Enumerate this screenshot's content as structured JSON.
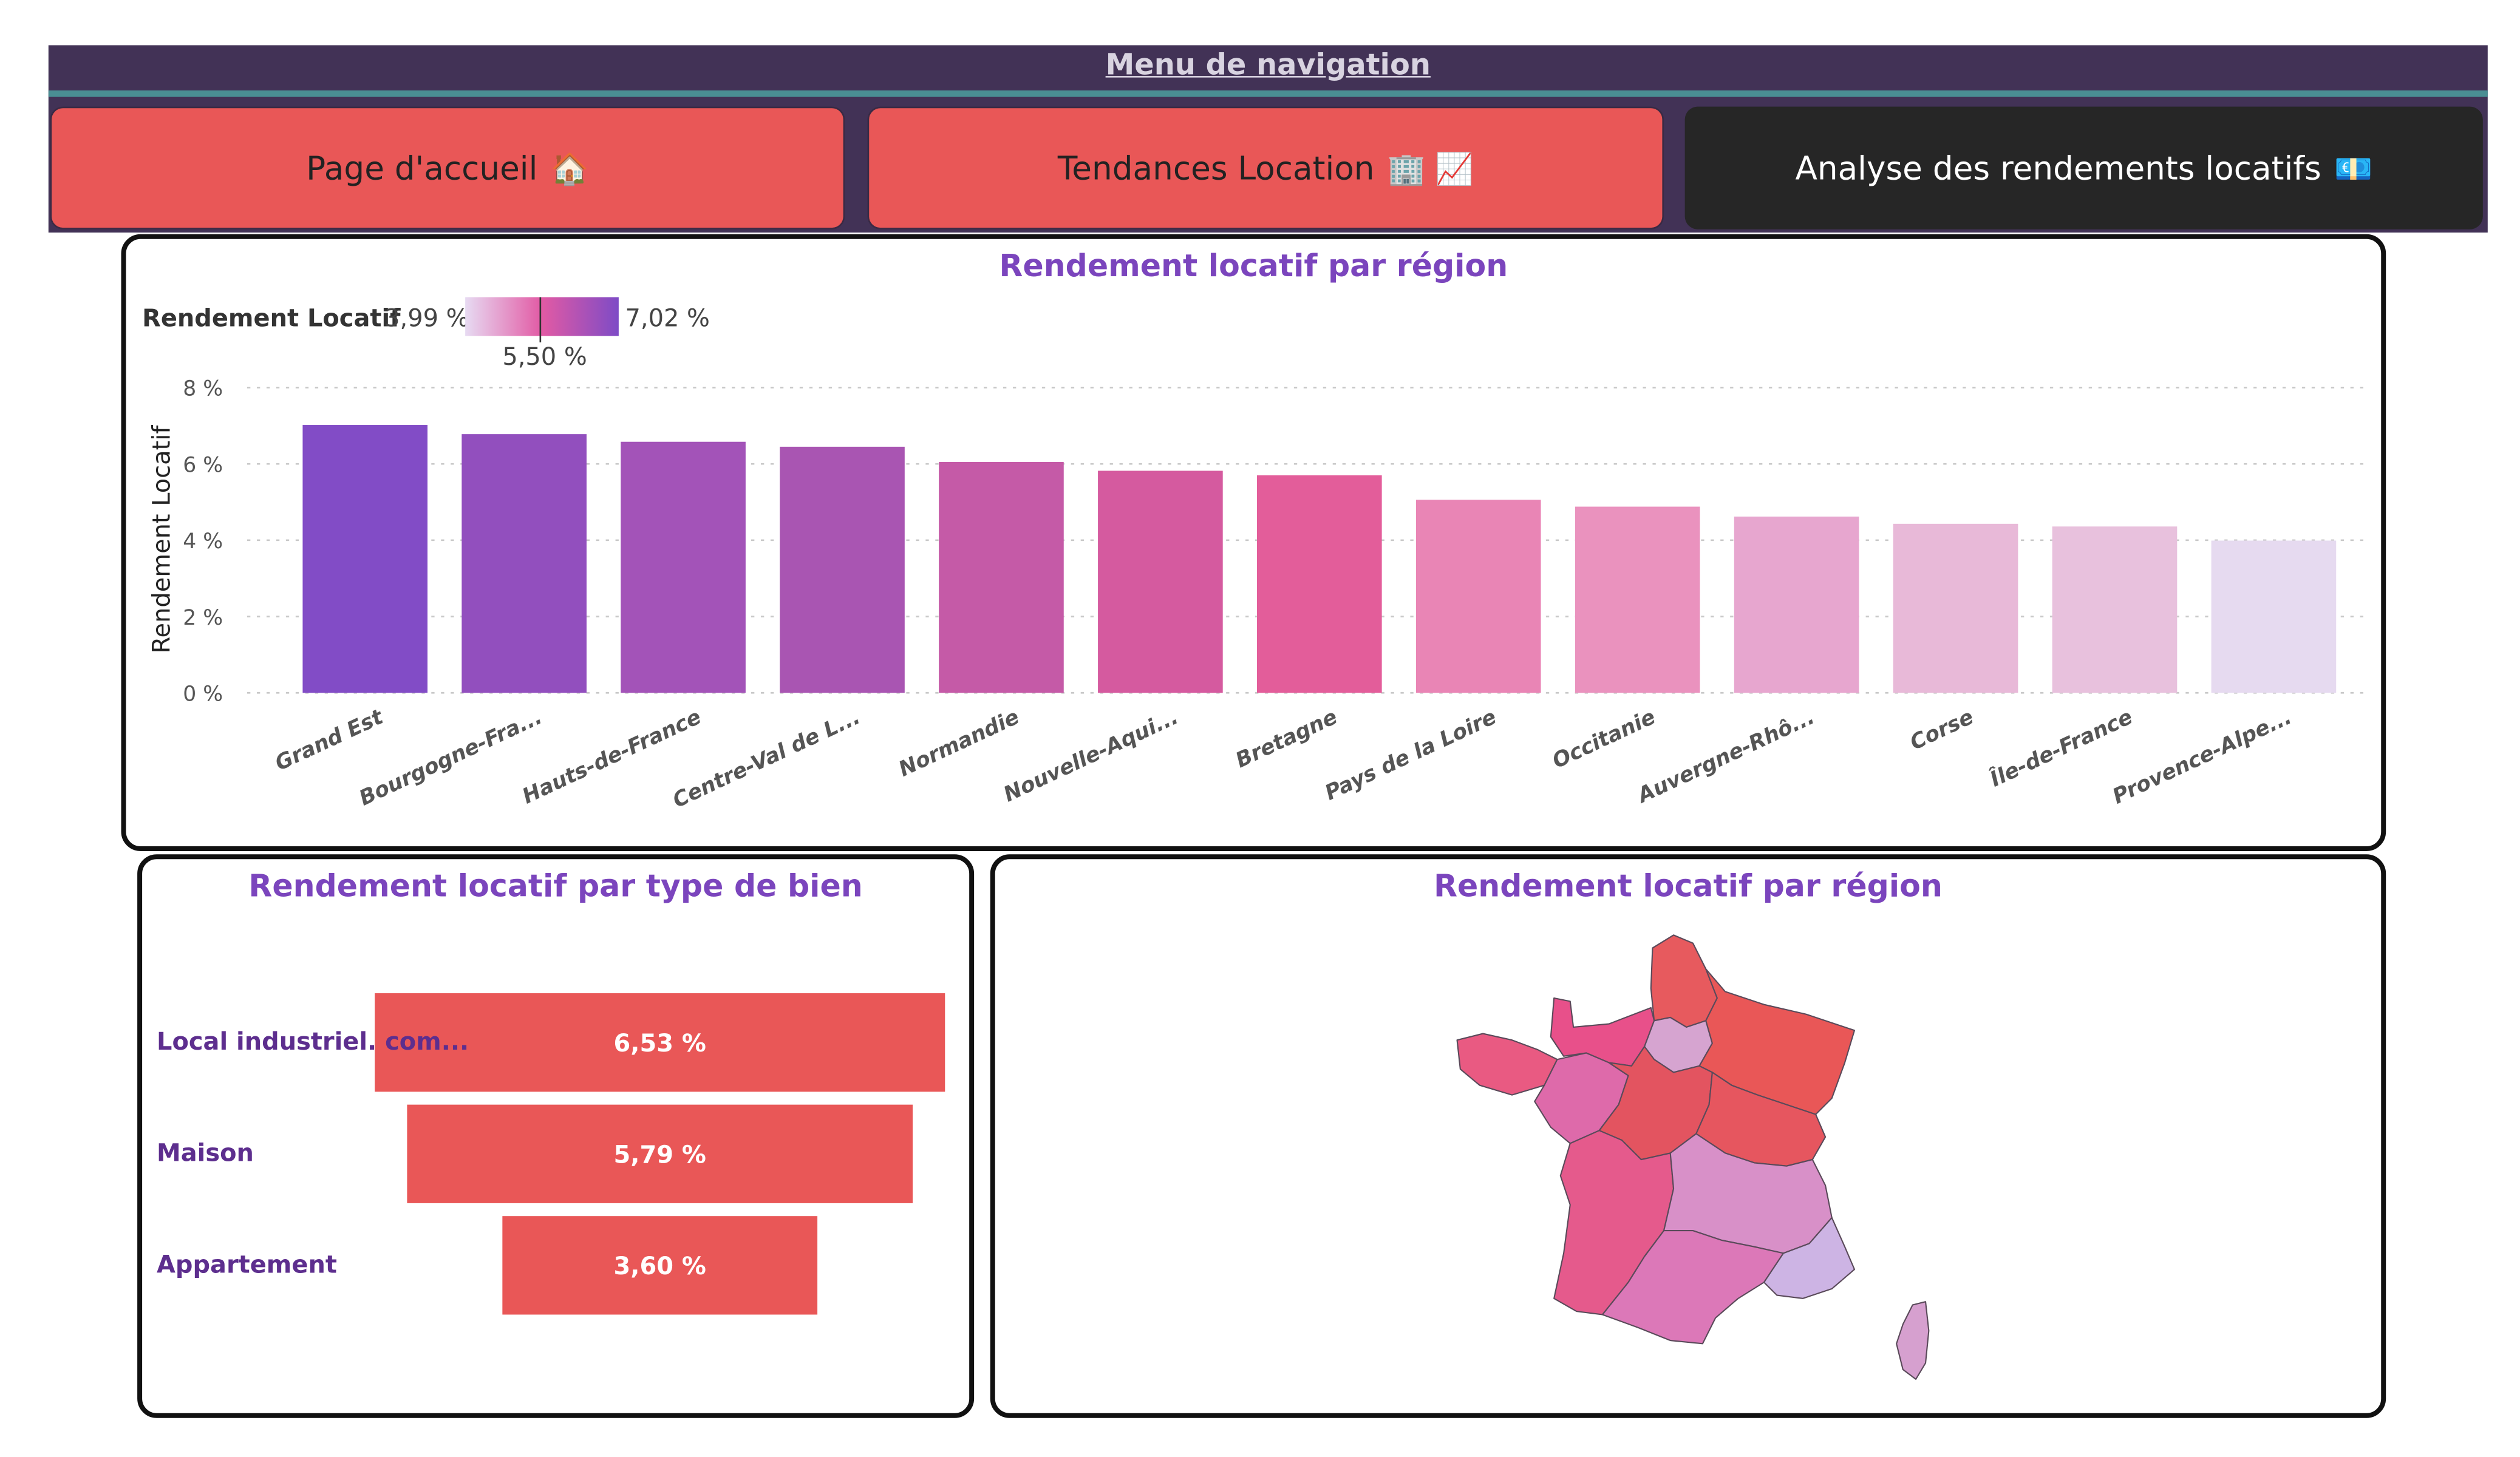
{
  "nav": {
    "title": "Menu de navigation",
    "buttons": [
      {
        "label": "Page d'accueil",
        "icon": "🏠",
        "active": false
      },
      {
        "label": "Tendances Location",
        "icon": "🏢 📈",
        "active": false
      },
      {
        "label": "Analyse des rendements locatifs",
        "icon": "💶",
        "active": true
      }
    ]
  },
  "region_chart": {
    "title": "Rendement locatif par région",
    "legend": {
      "name": "Rendement Locatif",
      "min": "3,99 %",
      "mid": "5,50 %",
      "max": "7,02 %"
    }
  },
  "chart_data": [
    {
      "type": "bar",
      "title": "Rendement locatif par région",
      "ylabel": "Rendement Locatif",
      "xlabel": "",
      "ylim": [
        0,
        8
      ],
      "yticks": [
        "0 %",
        "2 %",
        "4 %",
        "6 %",
        "8 %"
      ],
      "grid": true,
      "categories": [
        "Grand Est",
        "Bourgogne-Fra...",
        "Hauts-de-France",
        "Centre-Val de L...",
        "Normandie",
        "Nouvelle-Aqui...",
        "Bretagne",
        "Pays de la Loire",
        "Occitanie",
        "Auvergne-Rhô...",
        "Corse",
        "Île-de-France",
        "Provence-Alpe..."
      ],
      "values": [
        7.02,
        6.78,
        6.58,
        6.45,
        6.05,
        5.82,
        5.7,
        5.06,
        4.88,
        4.62,
        4.43,
        4.36,
        3.99
      ],
      "colors": [
        "#824cc6",
        "#924fbe",
        "#a353b8",
        "#a955b2",
        "#c55aa7",
        "#d55a9f",
        "#e35d9a",
        "#e985b5",
        "#ea92be",
        "#e7a6cf",
        "#e8b9d8",
        "#e8c1dd",
        "#e6daf0"
      ]
    },
    {
      "type": "bar",
      "orientation": "funnel",
      "title": "Rendement locatif par type de bien",
      "categories": [
        "Local industriel. com...",
        "Maison",
        "Appartement"
      ],
      "values": [
        6.53,
        5.79,
        3.6
      ],
      "labels": [
        "6,53 %",
        "5,79 %",
        "3,60 %"
      ]
    }
  ],
  "map": {
    "title": "Rendement locatif par région",
    "regions": {
      "hauts-de-france": "#e75a5e",
      "normandie": "#e8508a",
      "ile-de-france": "#d6a4d0",
      "grand-est": "#e95757",
      "bretagne": "#e95a82",
      "pays-de-la-loire": "#de6aaa",
      "centre-val-de-loire": "#e35460",
      "bourgogne-franche-comte": "#e6565f",
      "nouvelle-aquitaine": "#e55a8c",
      "auvergne-rhone-alpes": "#d890c8",
      "occitanie": "#dc78b8",
      "provence-alpes-cote-dazur": "#cdb4e4",
      "corse": "#d6a0cf"
    }
  }
}
